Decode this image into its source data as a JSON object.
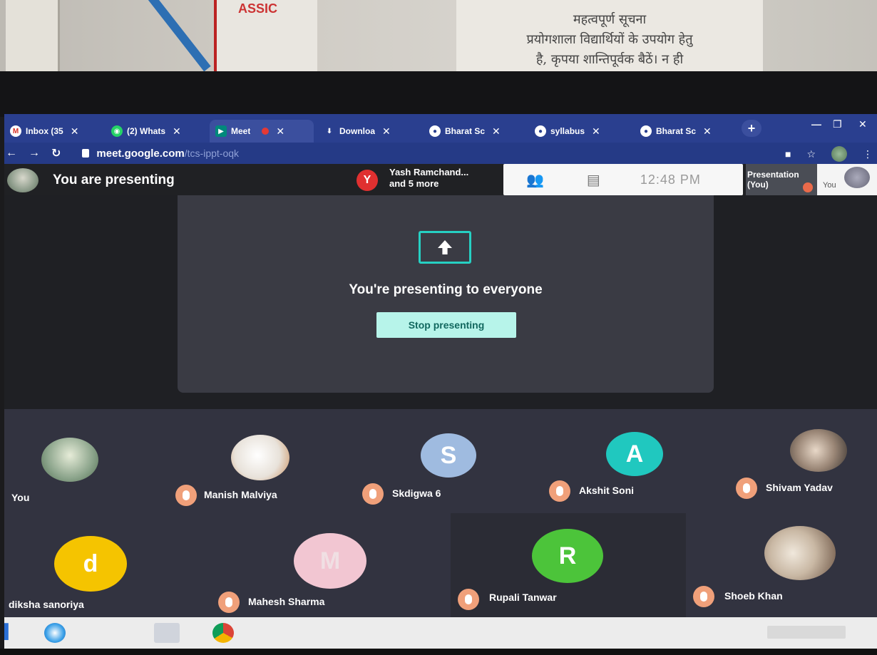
{
  "room": {
    "poster_text": "ASSIC",
    "notice_lines": [
      "महत्वपूर्ण सूचना",
      "प्रयोगशाला विद्यार्थियों के उपयोग हेतु",
      "है, कृपया शान्तिपूर्वक बैठें। न ही"
    ]
  },
  "browser": {
    "tabs": [
      {
        "label": "Inbox (35",
        "icon": "gmail-icon",
        "color": "#d93025"
      },
      {
        "label": "(2) Whats",
        "icon": "whatsapp-icon",
        "color": "#25d366"
      },
      {
        "label": "Meet",
        "icon": "meet-icon",
        "color": "#00897b",
        "active": true
      },
      {
        "label": "Downloa",
        "icon": "download-icon",
        "color": "#ffffff"
      },
      {
        "label": "Bharat Sc",
        "icon": "chrome-icon",
        "color": "#ffffff"
      },
      {
        "label": "syllabus",
        "icon": "chrome-icon",
        "color": "#ffffff"
      },
      {
        "label": "Bharat Sc",
        "icon": "chrome-icon",
        "color": "#ffffff"
      }
    ],
    "close_glyph": "✕",
    "new_tab_glyph": "+",
    "url_host": "meet.google.com",
    "url_path": "/tcs-ippt-oqk"
  },
  "meet": {
    "header_title": "You are presenting",
    "participants_avatar_letter": "Y",
    "participants_line1": "Yash Ramchand...",
    "participants_line2": "and 5 more",
    "clock": "12:48 PM",
    "presentation_tile_line1": "Presentation",
    "presentation_tile_line2": "(You)",
    "you_tile_label": "You",
    "presenting_message": "You're presenting to everyone",
    "stop_button_label": "Stop presenting"
  },
  "participants": [
    {
      "name": "You",
      "type": "photo",
      "color": "#8aa38a",
      "muted": false
    },
    {
      "name": "Manish Malviya",
      "type": "photo",
      "color": "#e8e2da",
      "muted": true
    },
    {
      "name": "Skdigwa 6",
      "type": "letter",
      "letter": "S",
      "color": "#9fbbe0",
      "muted": true
    },
    {
      "name": "Akshit Soni",
      "type": "letter",
      "letter": "A",
      "color": "#20c8bf",
      "muted": true
    },
    {
      "name": "Shivam Yadav",
      "type": "photo",
      "color": "#c9c3bc",
      "muted": true
    },
    {
      "name": "diksha sanoriya",
      "type": "letter",
      "letter": "d",
      "color": "#f5c400",
      "muted": false
    },
    {
      "name": "Mahesh Sharma",
      "type": "letter",
      "letter": "M",
      "color": "#f2c6d2",
      "muted": true
    },
    {
      "name": "Rupali Tanwar",
      "type": "letter",
      "letter": "R",
      "color": "#4cc43a",
      "muted": true
    },
    {
      "name": "Shoeb Khan",
      "type": "photo",
      "color": "#d8d0c4",
      "muted": true
    }
  ]
}
